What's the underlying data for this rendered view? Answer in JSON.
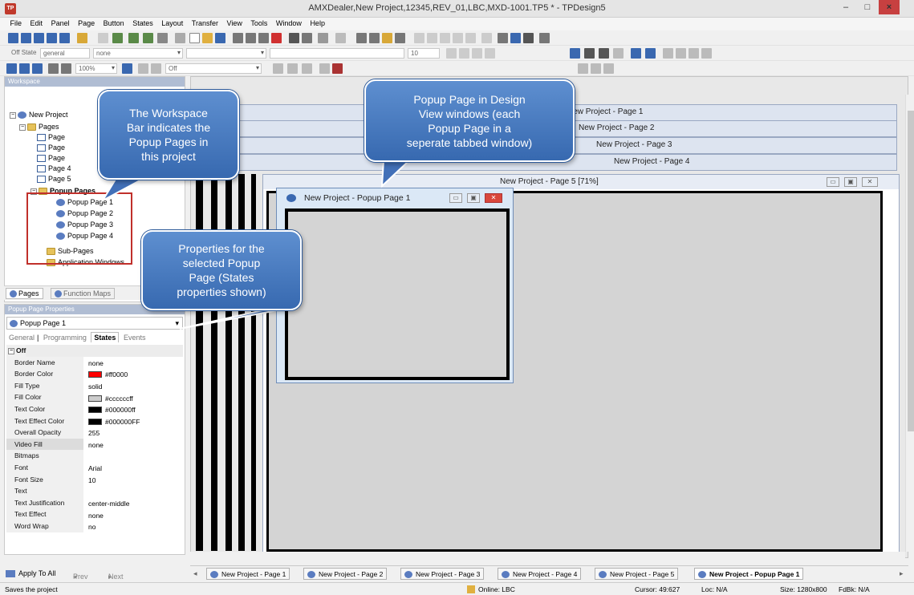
{
  "window": {
    "title": "AMXDealer,New Project,12345,REV_01,LBC,MXD-1001.TP5 * - TPDesign5",
    "app_icon": "tp-icon",
    "minimize": "–",
    "maximize": "□",
    "close": "×"
  },
  "menu": [
    "File",
    "Edit",
    "Panel",
    "Page",
    "Button",
    "States",
    "Layout",
    "Transfer",
    "View",
    "Tools",
    "Window",
    "Help"
  ],
  "toolbar2": {
    "state_label": "Off State",
    "state_value": "general",
    "font_value": "none",
    "size_value": "10"
  },
  "toolbar3": {
    "zoom_value": "100%",
    "state_value": "Off"
  },
  "workspace": {
    "header": "Workspace",
    "tree": {
      "root": "New Project",
      "pages_folder": "Pages",
      "pages": [
        "Page",
        "Page",
        "Page",
        "Page 4",
        "Page 5"
      ],
      "popup_folder": "Popup Pages",
      "popups": [
        "Popup Page 1",
        "Popup Page 2",
        "Popup Page 3",
        "Popup Page 4"
      ],
      "subpages": "Sub-Pages",
      "appwindows": "Application Windows"
    },
    "tabs": [
      "Pages",
      "Function Maps"
    ]
  },
  "properties": {
    "header": "Popup Page Properties",
    "selected": "Popup Page 1",
    "tabs": [
      "General",
      "Programming",
      "States",
      "Events"
    ],
    "category": "Off",
    "rows": [
      {
        "key": "Border Name",
        "value": "none"
      },
      {
        "key": "Border Color",
        "value": "#ff0000",
        "swatch": "#ff0000"
      },
      {
        "key": "Fill Type",
        "value": "solid"
      },
      {
        "key": "Fill Color",
        "value": "#ccccccff",
        "swatch": "#cccccc"
      },
      {
        "key": "Text Color",
        "value": "#000000ff",
        "swatch": "#000000"
      },
      {
        "key": "Text Effect Color",
        "value": "#000000FF",
        "swatch": "#000000"
      },
      {
        "key": "Overall Opacity",
        "value": "255"
      },
      {
        "key": "Video Fill",
        "value": "none"
      },
      {
        "key": "Bitmaps",
        "value": ""
      },
      {
        "key": "Font",
        "value": "Arial"
      },
      {
        "key": "Font Size",
        "value": "10"
      },
      {
        "key": "Text",
        "value": ""
      },
      {
        "key": "Text Justification",
        "value": "center-middle"
      },
      {
        "key": "Text Effect",
        "value": "none"
      },
      {
        "key": "Word Wrap",
        "value": "no"
      }
    ]
  },
  "nav": {
    "apply_all": "Apply To All",
    "prev": "Prev",
    "next": "Next"
  },
  "design": {
    "cascade": [
      "New Project - Page 1",
      "New Project - Page 2",
      "New Project - Page 3",
      "New Project - Page 4"
    ],
    "page5_title": "New Project - Page 5  [71%]",
    "popup1_title": "New Project - Popup Page 1"
  },
  "bottom_tabs": [
    "New Project - Page 1",
    "New Project - Page 2",
    "New Project - Page 3",
    "New Project - Page 4",
    "New Project - Page 5",
    "New Project - Popup Page 1"
  ],
  "status": {
    "message": "Saves the project",
    "online": "Online: LBC",
    "cursor": "Cursor: 49:627",
    "loc": "Loc: N/A",
    "size": "Size: 1280x800",
    "fdbk": "FdBk: N/A"
  },
  "callouts": {
    "workspace": [
      "The Workspace",
      "Bar indicates the",
      "Popup Pages in",
      "this project"
    ],
    "design": [
      "Popup Page in Design",
      "View windows (each",
      "Popup Page in a",
      "seperate tabbed window)"
    ],
    "properties": [
      "Properties for the",
      "selected Popup",
      "Page (States",
      "properties shown)"
    ]
  },
  "colors": {
    "callout": "#4a7cc2",
    "highlight": "#c0302b",
    "close": "#c74040"
  }
}
